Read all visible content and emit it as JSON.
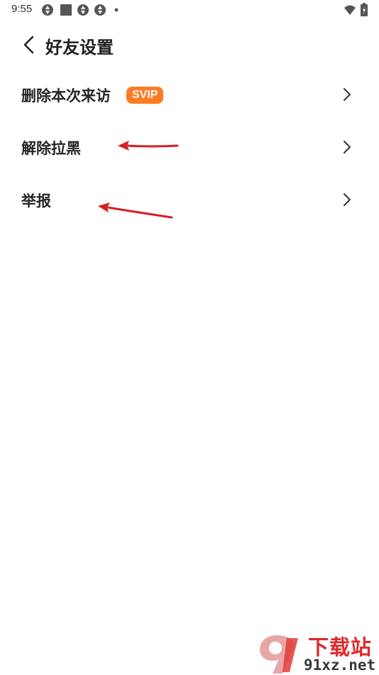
{
  "status_bar": {
    "time": "9:55",
    "icons": [
      "sync-icon",
      "app-square-icon",
      "sync-icon",
      "sync-icon",
      "dot-icon",
      "wifi-icon",
      "battery-icon"
    ]
  },
  "header": {
    "title": "好友设置"
  },
  "menu": {
    "items": [
      {
        "label": "删除本次来访",
        "badge": "SVIP"
      },
      {
        "label": "解除拉黑"
      },
      {
        "label": "举报"
      }
    ]
  },
  "watermark": {
    "logo_text": "9",
    "title": "下载站",
    "domain": "91xz.net"
  },
  "colors": {
    "badge": "#ff7a22",
    "annotation_arrow": "#d61f1f",
    "watermark_red": "#dd2a2a"
  }
}
